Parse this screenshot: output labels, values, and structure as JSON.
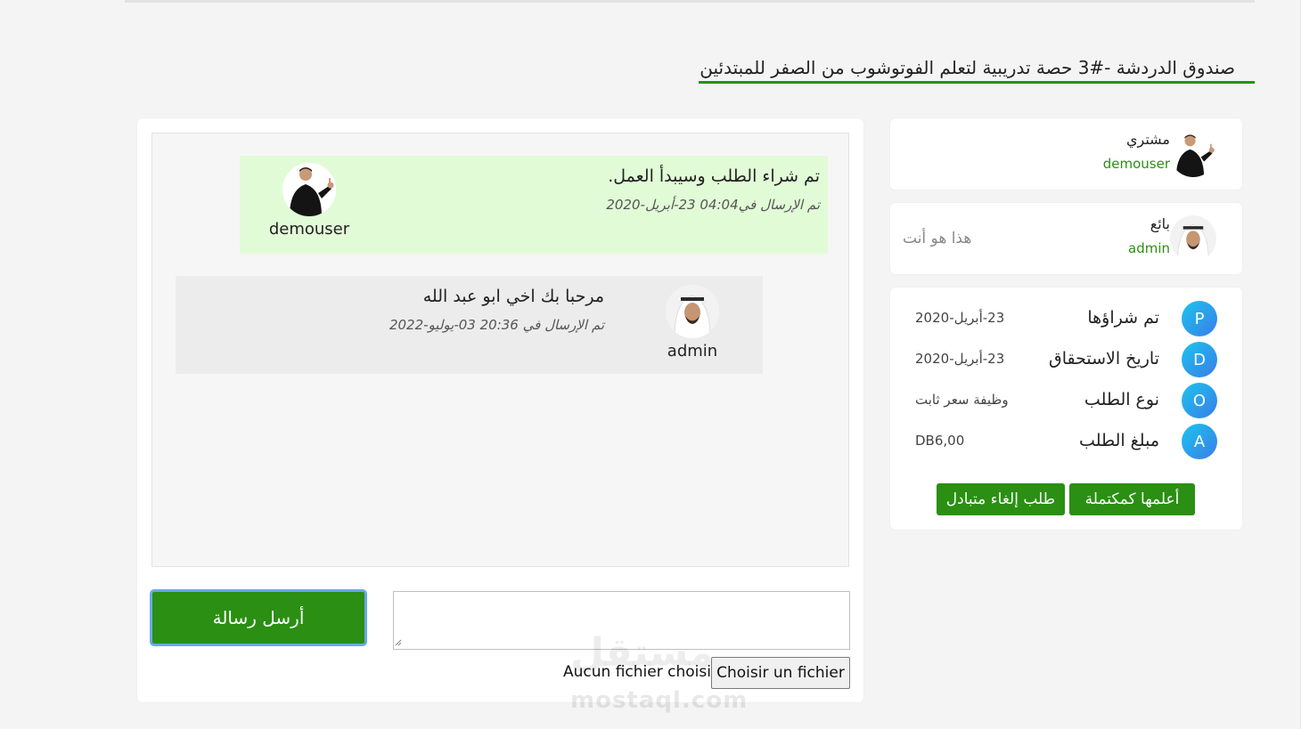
{
  "page": {
    "title": "صندوق الدردشة -#3 حصة تدريبية لتعلم الفوتوشوب من الصفر للمبتدئين"
  },
  "chat": {
    "messages": [
      {
        "text": "تم شراء الطلب وسيبدأ العمل.",
        "time": "تم الإرسال في04:04 23-أبريل-2020",
        "user": "demouser",
        "avatar": "buyer-avatar"
      },
      {
        "text": "مرحبا بك اخي ابو عبد الله",
        "time": "تم الإرسال في 20:36 03-يوليو-2022",
        "user": "admin",
        "avatar": "seller-avatar"
      }
    ],
    "send_label": "أرسل رسالة",
    "message_placeholder": "",
    "file_button_label": "Choisir un fichier",
    "file_status": "Aucun fichier choisi"
  },
  "buyer": {
    "role": "مشتري",
    "username": "demouser"
  },
  "seller": {
    "role": "بائع",
    "username": "admin",
    "you_label": "هذا هو أنت"
  },
  "order_info": [
    {
      "badge": "P",
      "label": "تم شراؤها",
      "value": "23-أبريل-2020"
    },
    {
      "badge": "D",
      "label": "تاريخ الاستحقاق",
      "value": "23-أبريل-2020"
    },
    {
      "badge": "O",
      "label": "نوع الطلب",
      "value": "وظيفة سعر ثابت"
    },
    {
      "badge": "A",
      "label": "مبلغ الطلب",
      "value": "DB6,00"
    }
  ],
  "actions": {
    "complete_label": "أعلمها كمكتملة",
    "cancel_label": "طلب إلغاء متبادل"
  },
  "watermark": {
    "arabic": "مستقل",
    "latin": "mostaql.com"
  },
  "colors": {
    "accent_green": "#2a8f12",
    "bubble_green": "#e2fbd7",
    "bubble_gray": "#ececec",
    "badge_blue": "#3a7de8"
  }
}
